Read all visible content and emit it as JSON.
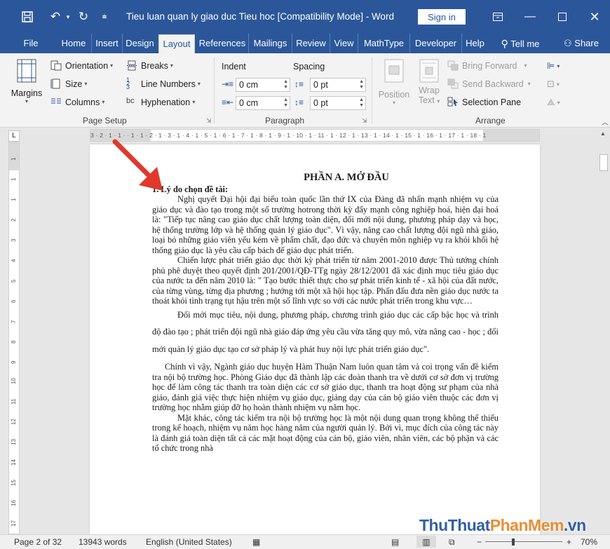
{
  "titlebar": {
    "title": "Tieu luan quan ly giao duc Tieu hoc [Compatibility Mode]  -  Word",
    "signin": "Sign in",
    "icons": [
      "save-icon",
      "undo-icon",
      "redo-icon",
      "customize-icon",
      "ribbon-display-icon",
      "minimize-icon",
      "maximize-icon",
      "close-icon"
    ]
  },
  "tabs": [
    "File",
    "Home",
    "Insert",
    "Design",
    "Layout",
    "References",
    "Mailings",
    "Review",
    "View",
    "MathType",
    "Developer",
    "Help"
  ],
  "tell_me": "Tell me",
  "share": "Share",
  "ribbon": {
    "page_setup": {
      "margins": "Margins",
      "orientation": "Orientation",
      "size": "Size",
      "columns": "Columns",
      "breaks": "Breaks",
      "line_numbers": "Line Numbers",
      "hyphenation": "Hyphenation",
      "label": "Page Setup"
    },
    "paragraph": {
      "indent": "Indent",
      "spacing": "Spacing",
      "indent_left": "0 cm",
      "indent_right": "0 cm",
      "spacing_before": "0 pt",
      "spacing_after": "0 pt",
      "label": "Paragraph"
    },
    "arrange": {
      "position": "Position",
      "wrap_text_1": "Wrap",
      "wrap_text_2": "Text",
      "bring_forward": "Bring Forward",
      "send_backward": "Send Backward",
      "selection_pane": "Selection Pane",
      "label": "Arrange"
    }
  },
  "ruler": {
    "h_ticks": "3 · 2 · 1 · 1 · · 1 · 1 · 2 · 1 · 3 · 1 · 4 · 1 · 5 · 1 · 6 · 1 · 7 · 1 · 8 · 1 · 9 · 1 · 10 · 1 · 11 · 1 · 12 · 1 · 13 · 1 · 14 · 1 · 15 · 1 · 16 · 1 · 17 · 1 · 18 · 1",
    "v_ticks": [
      "1",
      "1",
      "1",
      "2",
      "3",
      "4",
      "5",
      "6",
      "7",
      "8",
      "9",
      "10",
      "11",
      "12",
      "13",
      "14",
      "15",
      "16",
      "17"
    ]
  },
  "document": {
    "heading": "PHẦN A. MỞ ĐẦU",
    "subheading": "1. Lý do chọn đề tài:",
    "p1": "Nghị quyết Đại hội đại biểu toàn quốc lần thứ IX của Đảng đã nhấn mạnh nhiệm vụ của giáo dục và đào tạo  trong một số trường hotrong thời kỳ đẩy mạnh công nghiệp hoá, hiện đại hoá là: \"Tiếp tục nâng cao giáo dục chất lượng toàn diện, đổi mới nội dung, phương pháp dạy và học, hệ thống trường lớp và hệ thống quản lý giáo dục\". Vì vậy, nâng cao chất lượng đội ngũ nhà giáo, loại bỏ những giáo viên yếu kém về phẩm chất, đạo đức và chuyên môn nghiệp vụ ra khỏi khối hệ thống giáo dục là yêu cầu cấp bách để giáo dục phát triển.",
    "p2": "Chiến lược phát triển giáo dục thời kỳ phát triển từ năm 2001-2010 được Thủ tướng chính phủ phê duyệt theo quyết định 201/2001/QĐ-TTg ngày 28/12/2001 đã xác định mục tiêu giáo dục của nước ta đến năm 2010 là: \" Tạo bước thiết thực cho sự phát triển kinh tế - xã hội của đất nước, của từng vùng, từng địa phương ; hướng tới một xã hội học tập. Phấn đấu đưa nền giáo dục nước ta thoát khỏi tình trạng tụt hậu trên một số lĩnh vực so với các nước phát triển trong khu vực…",
    "p3": "Đổi mới mục tiêu, nội dung, phương pháp, chương trình giáo dục các cấp bậc học và trình độ đào tạo ; phát triển đội ngũ nhà giáo đáp ứng yêu cầu vừa tăng quy mô, vừa nâng cao - học ; đổi mới quản lý giáo dục tạo cơ sở pháp lý và phát huy nội lực phát triển giáo dục\".",
    "p4": "Chính vì vậy, Ngành giáo dục huyện Hàm Thuận Nam luôn quan tâm và coi trọng vấn đề kiểm tra nội bộ trường học. Phòng Giáo dục đã thành lập các đoàn thanh tra về dưới cơ sở đơn vị trường học để làm công tác thanh tra toàn diện các cơ sở giáo dục, thanh tra hoạt động sư phạm của nhà      giáo, đánh giá việc thực hiện nhiệm vụ giáo dục, giảng dạy của cán bộ giáo viên thuộc các đơn vị trường học nhằm giúp đỡ họ hoàn thành nhiệm vụ năm học.",
    "p5": "Mặt khác, công tác kiểm tra nội bộ trường học là một nội dung quan trọng không thể thiếu trong kế hoạch, nhiệm vụ năm học hàng năm của người quản lý. Bởi vì, mục đích của công tác này là đánh giá toàn diện tất cả các mặt hoạt động của cán bộ, giáo viên, nhân viên, các bộ phận và các tổ chức trong nhà"
  },
  "statusbar": {
    "page": "Page 2 of 32",
    "words": "13943 words",
    "language": "English (United States)",
    "zoom": "70%",
    "zoom_minus": "−",
    "zoom_plus": "+"
  },
  "watermark": {
    "part1": "Thu",
    "part2": "Thuat",
    "part3": "PhanMem",
    "part4": ".vn"
  },
  "colors": {
    "word_blue": "#2b579a",
    "ribbon_bg": "#f3f3f3",
    "arrow_red": "#e0392b"
  }
}
